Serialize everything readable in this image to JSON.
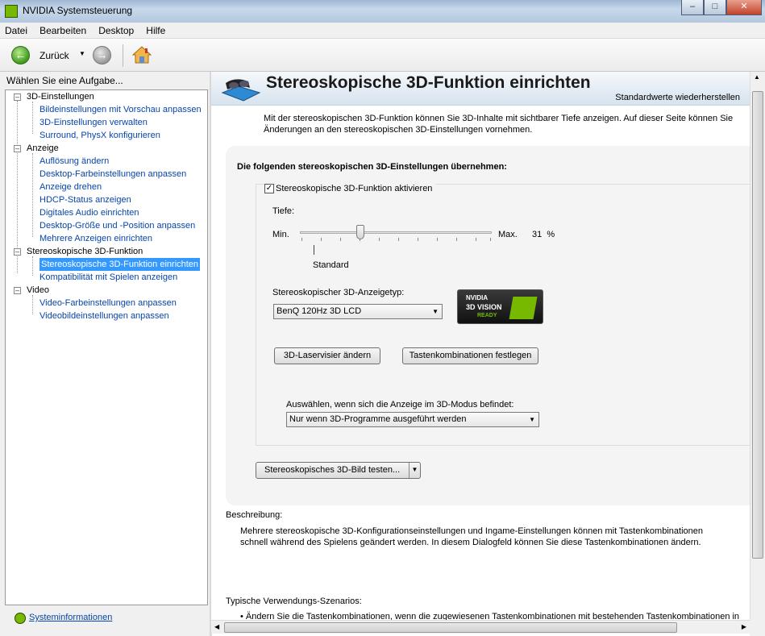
{
  "window": {
    "title": "NVIDIA Systemsteuerung",
    "controls": [
      "–",
      "□",
      "✕"
    ]
  },
  "menu": [
    "Datei",
    "Bearbeiten",
    "Desktop",
    "Hilfe"
  ],
  "toolbar": {
    "back_label": "Zurück"
  },
  "sidebar": {
    "heading": "Wählen Sie eine Aufgabe...",
    "categories": [
      {
        "label": "3D-Einstellungen",
        "items": [
          "Bildeinstellungen mit Vorschau anpassen",
          "3D-Einstellungen verwalten",
          "Surround, PhysX konfigurieren"
        ]
      },
      {
        "label": "Anzeige",
        "items": [
          "Auflösung ändern",
          "Desktop-Farbeinstellungen anpassen",
          "Anzeige drehen",
          "HDCP-Status anzeigen",
          "Digitales Audio einrichten",
          "Desktop-Größe und -Position anpassen",
          "Mehrere Anzeigen einrichten"
        ]
      },
      {
        "label": "Stereoskopische 3D-Funktion",
        "items": [
          "Stereoskopische 3D-Funktion einrichten",
          "Kompatibilität mit Spielen anzeigen"
        ]
      },
      {
        "label": "Video",
        "items": [
          "Video-Farbeinstellungen anpassen",
          "Videobildeinstellungen anpassen"
        ]
      }
    ],
    "selected": "Stereoskopische 3D-Funktion einrichten",
    "footer_link": "Systeminformationen"
  },
  "page": {
    "title": "Stereoskopische 3D-Funktion einrichten",
    "restore_link": "Standardwerte wiederherstellen",
    "intro": "Mit der stereoskopischen 3D-Funktion können Sie 3D-Inhalte mit sichtbarer Tiefe anzeigen. Auf dieser Seite können Sie Änderungen an den stereoskopischen 3D-Einstellungen vornehmen.",
    "section_heading": "Die folgenden stereoskopischen 3D-Einstellungen übernehmen:",
    "enable_checkbox": {
      "label": "Stereoskopische 3D-Funktion aktivieren",
      "checked": true
    },
    "depth": {
      "label": "Tiefe:",
      "min_label": "Min.",
      "max_label": "Max.",
      "value_percent": 31,
      "value_text": "31",
      "unit": "%",
      "standard_label": "Standard"
    },
    "display_type": {
      "label": "Stereoskopischer 3D-Anzeigetyp:",
      "selected": "BenQ 120Hz 3D LCD"
    },
    "badge": {
      "line1": "NVIDIA",
      "line2": "3D VISION",
      "line3": "READY"
    },
    "buttons": {
      "laser": "3D-Laservisier ändern",
      "hotkeys": "Tastenkombinationen festlegen"
    },
    "mode": {
      "label": "Auswählen, wenn sich die Anzeige im 3D-Modus befindet:",
      "selected": "Nur wenn 3D-Programme ausgeführt werden"
    },
    "test_button": "Stereoskopisches 3D-Bild testen...",
    "description_label": "Beschreibung:",
    "description": "Mehrere stereoskopische 3D-Konfigurationseinstellungen und Ingame-Einstellungen können mit Tastenkombinationen schnell während des Spielens geändert werden. In diesem Dialogfeld können Sie diese Tastenkombinationen ändern.",
    "usage_label": "Typische Verwendungs-Szenarios:",
    "usage_item": "• Ändern Sie die Tastenkombinationen, wenn die zugewiesenen Tastenkombinationen mit bestehenden Tastenkombinationen in"
  },
  "colors": {
    "accent": "#76b900",
    "link": "#0645ad",
    "selection": "#3399ff"
  }
}
